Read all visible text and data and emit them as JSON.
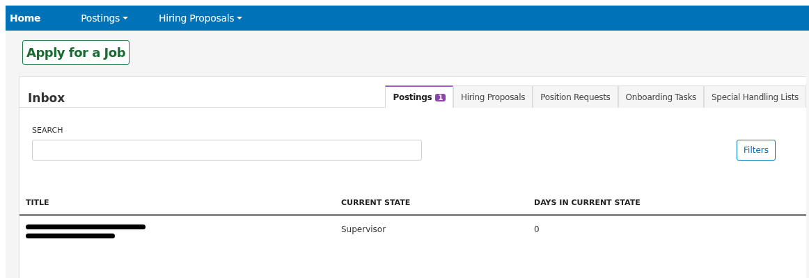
{
  "navbar": {
    "items": [
      {
        "label": "Home",
        "kind": "link",
        "selected": true
      },
      {
        "label": "Postings",
        "kind": "dropdown",
        "selected": false
      },
      {
        "label": "Hiring Proposals",
        "kind": "dropdown",
        "selected": false
      }
    ]
  },
  "apply_button": "Apply for a Job",
  "inbox": {
    "title": "Inbox",
    "tabs": [
      {
        "label": "Postings",
        "badge": "1",
        "selected": true
      },
      {
        "label": "Hiring Proposals",
        "selected": false
      },
      {
        "label": "Position Requests",
        "selected": false
      },
      {
        "label": "Onboarding Tasks",
        "selected": false
      },
      {
        "label": "Special Handling Lists",
        "selected": false
      }
    ],
    "search": {
      "label": "SEARCH"
    },
    "filters_button": "Filters",
    "table": {
      "columns": [
        "TITLE",
        "CURRENT STATE",
        "DAYS IN CURRENT STATE"
      ],
      "rows": [
        {
          "title_redacted": true,
          "current_state": "Supervisor",
          "days": "0"
        }
      ]
    }
  }
}
